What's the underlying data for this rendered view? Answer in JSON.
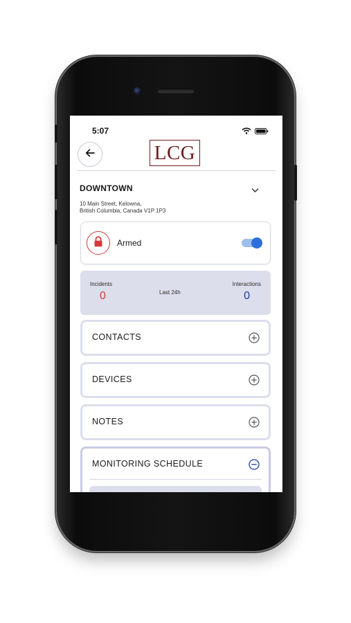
{
  "status_bar": {
    "time": "5:07"
  },
  "header": {
    "logo_text": "LCG"
  },
  "location": {
    "name": "DOWNTOWN",
    "address_line1": "10 Main Street, Kelowna,",
    "address_line2": "British Columbia, Canada V1P 1P3"
  },
  "alarm": {
    "status_label": "Armed",
    "toggle_on": true
  },
  "stats": {
    "incidents_label": "Incidents",
    "incidents_value": "0",
    "period_label": "Last 24h",
    "interactions_label": "Interactions",
    "interactions_value": "0"
  },
  "sections": {
    "contacts": "CONTACTS",
    "devices": "DEVICES",
    "notes": "NOTES",
    "monitoring_schedule": "MONITORING SCHEDULE"
  },
  "colors": {
    "accent_blue": "#2f6fdc",
    "alert_red": "#d73a3a",
    "logo_maroon": "#6b1d1d",
    "panel_lavender": "#dcdeec"
  }
}
